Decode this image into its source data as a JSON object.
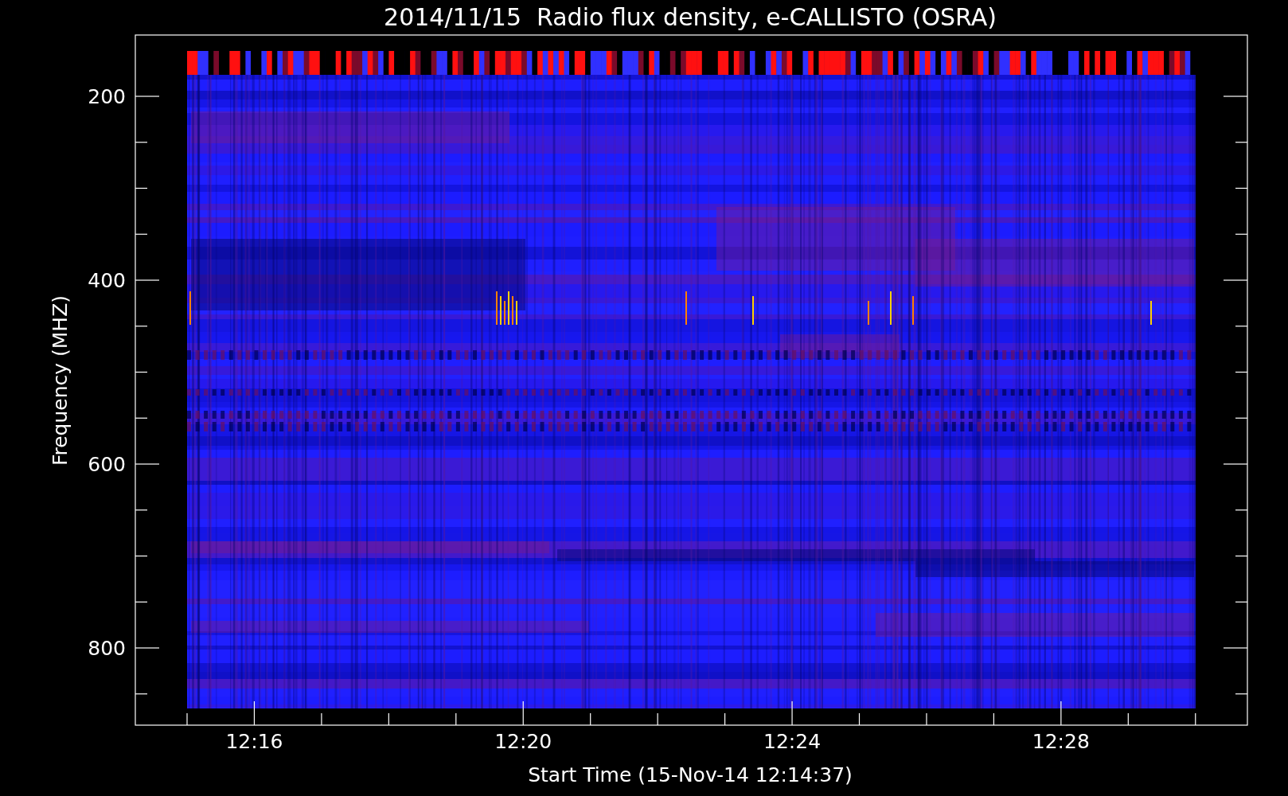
{
  "title": "2014/11/15  Radio flux density, e-CALLISTO (OSRA)",
  "y_axis": {
    "label": "Frequency (MHZ)",
    "ticks": [
      "200",
      "400",
      "600",
      "800"
    ]
  },
  "x_axis": {
    "label": "Start Time (15-Nov-14 12:14:37)",
    "ticks": [
      "12:16",
      "12:20",
      "12:24",
      "12:28"
    ]
  }
}
